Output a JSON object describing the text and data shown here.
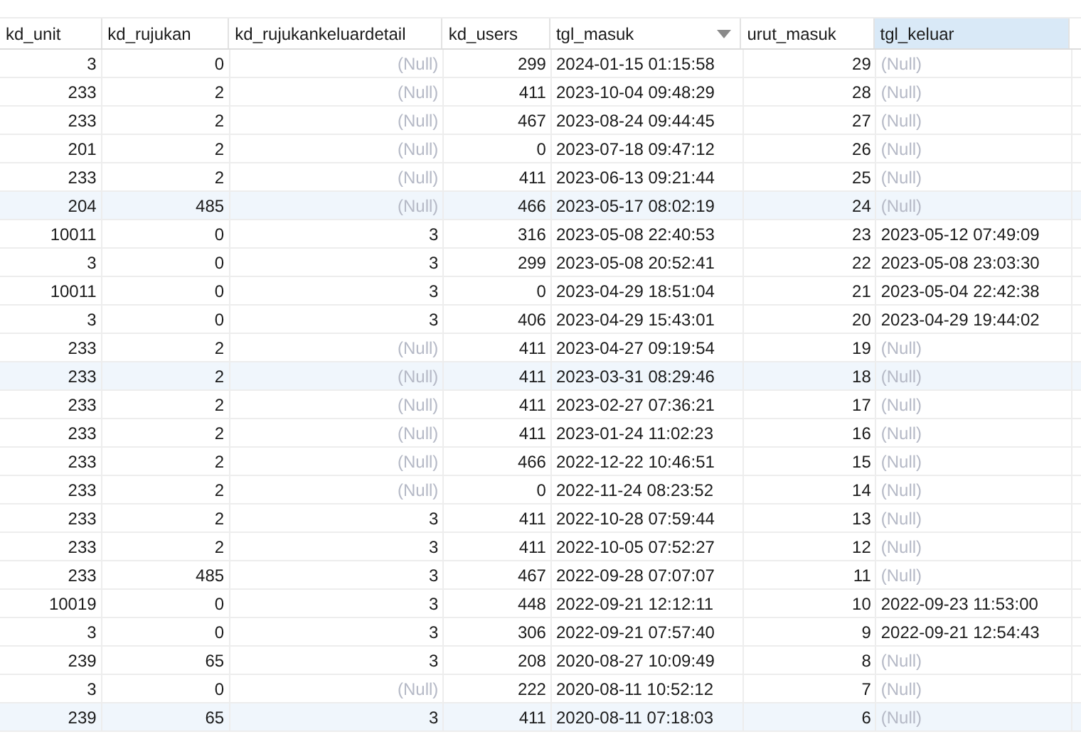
{
  "table": {
    "columns": [
      {
        "label": "kd_unit",
        "kind": "number",
        "sorted": false,
        "selected": false
      },
      {
        "label": "kd_rujukan",
        "kind": "number",
        "sorted": false,
        "selected": false
      },
      {
        "label": "kd_rujukankeluardetail",
        "kind": "number",
        "sorted": false,
        "selected": false
      },
      {
        "label": "kd_users",
        "kind": "number",
        "sorted": false,
        "selected": false
      },
      {
        "label": "tgl_masuk",
        "kind": "datetime",
        "sorted": true,
        "selected": false
      },
      {
        "label": "urut_masuk",
        "kind": "number",
        "sorted": false,
        "selected": false
      },
      {
        "label": "tgl_keluar",
        "kind": "datetime",
        "sorted": false,
        "selected": true
      }
    ],
    "rows": [
      {
        "selected": false,
        "cells": [
          "3",
          "0",
          {
            "null": "(Null)"
          },
          "299",
          "2024-01-15 01:15:58",
          "29",
          {
            "null": "(Null)"
          }
        ]
      },
      {
        "selected": false,
        "cells": [
          "233",
          "2",
          {
            "null": "(Null)"
          },
          "411",
          "2023-10-04 09:48:29",
          "28",
          {
            "null": "(Null)"
          }
        ]
      },
      {
        "selected": false,
        "cells": [
          "233",
          "2",
          {
            "null": "(Null)"
          },
          "467",
          "2023-08-24 09:44:45",
          "27",
          {
            "null": "(Null)"
          }
        ]
      },
      {
        "selected": false,
        "cells": [
          "201",
          "2",
          {
            "null": "(Null)"
          },
          "0",
          "2023-07-18 09:47:12",
          "26",
          {
            "null": "(Null)"
          }
        ]
      },
      {
        "selected": false,
        "cells": [
          "233",
          "2",
          {
            "null": "(Null)"
          },
          "411",
          "2023-06-13 09:21:44",
          "25",
          {
            "null": "(Null)"
          }
        ]
      },
      {
        "selected": true,
        "cells": [
          "204",
          "485",
          {
            "null": "(Null)"
          },
          "466",
          "2023-05-17 08:02:19",
          "24",
          {
            "null": "(Null)"
          }
        ]
      },
      {
        "selected": false,
        "cells": [
          "10011",
          "0",
          "3",
          "316",
          "2023-05-08 22:40:53",
          "23",
          "2023-05-12 07:49:09"
        ]
      },
      {
        "selected": false,
        "cells": [
          "3",
          "0",
          "3",
          "299",
          "2023-05-08 20:52:41",
          "22",
          "2023-05-08 23:03:30"
        ]
      },
      {
        "selected": false,
        "cells": [
          "10011",
          "0",
          "3",
          "0",
          "2023-04-29 18:51:04",
          "21",
          "2023-05-04 22:42:38"
        ]
      },
      {
        "selected": false,
        "cells": [
          "3",
          "0",
          "3",
          "406",
          "2023-04-29 15:43:01",
          "20",
          "2023-04-29 19:44:02"
        ]
      },
      {
        "selected": false,
        "cells": [
          "233",
          "2",
          {
            "null": "(Null)"
          },
          "411",
          "2023-04-27 09:19:54",
          "19",
          {
            "null": "(Null)"
          }
        ]
      },
      {
        "selected": true,
        "cells": [
          "233",
          "2",
          {
            "null": "(Null)"
          },
          "411",
          "2023-03-31 08:29:46",
          "18",
          {
            "null": "(Null)"
          }
        ]
      },
      {
        "selected": false,
        "cells": [
          "233",
          "2",
          {
            "null": "(Null)"
          },
          "411",
          "2023-02-27 07:36:21",
          "17",
          {
            "null": "(Null)"
          }
        ]
      },
      {
        "selected": false,
        "cells": [
          "233",
          "2",
          {
            "null": "(Null)"
          },
          "411",
          "2023-01-24 11:02:23",
          "16",
          {
            "null": "(Null)"
          }
        ]
      },
      {
        "selected": false,
        "cells": [
          "233",
          "2",
          {
            "null": "(Null)"
          },
          "466",
          "2022-12-22 10:46:51",
          "15",
          {
            "null": "(Null)"
          }
        ]
      },
      {
        "selected": false,
        "cells": [
          "233",
          "2",
          {
            "null": "(Null)"
          },
          "0",
          "2022-11-24 08:23:52",
          "14",
          {
            "null": "(Null)"
          }
        ]
      },
      {
        "selected": false,
        "cells": [
          "233",
          "2",
          "3",
          "411",
          "2022-10-28 07:59:44",
          "13",
          {
            "null": "(Null)"
          }
        ]
      },
      {
        "selected": false,
        "cells": [
          "233",
          "2",
          "3",
          "411",
          "2022-10-05 07:52:27",
          "12",
          {
            "null": "(Null)"
          }
        ]
      },
      {
        "selected": false,
        "cells": [
          "233",
          "485",
          "3",
          "467",
          "2022-09-28 07:07:07",
          "11",
          {
            "null": "(Null)"
          }
        ]
      },
      {
        "selected": false,
        "cells": [
          "10019",
          "0",
          "3",
          "448",
          "2022-09-21 12:12:11",
          "10",
          "2022-09-23 11:53:00"
        ]
      },
      {
        "selected": false,
        "cells": [
          "3",
          "0",
          "3",
          "306",
          "2022-09-21 07:57:40",
          "9",
          "2022-09-21 12:54:43"
        ]
      },
      {
        "selected": false,
        "cells": [
          "239",
          "65",
          "3",
          "208",
          "2020-08-27 10:09:49",
          "8",
          {
            "null": "(Null)"
          }
        ]
      },
      {
        "selected": false,
        "cells": [
          "3",
          "0",
          {
            "null": "(Null)"
          },
          "222",
          "2020-08-11 10:52:12",
          "7",
          {
            "null": "(Null)"
          }
        ]
      },
      {
        "selected": true,
        "cells": [
          "239",
          "65",
          "3",
          "411",
          "2020-08-11 07:18:03",
          "6",
          {
            "null": "(Null)"
          }
        ]
      }
    ]
  }
}
